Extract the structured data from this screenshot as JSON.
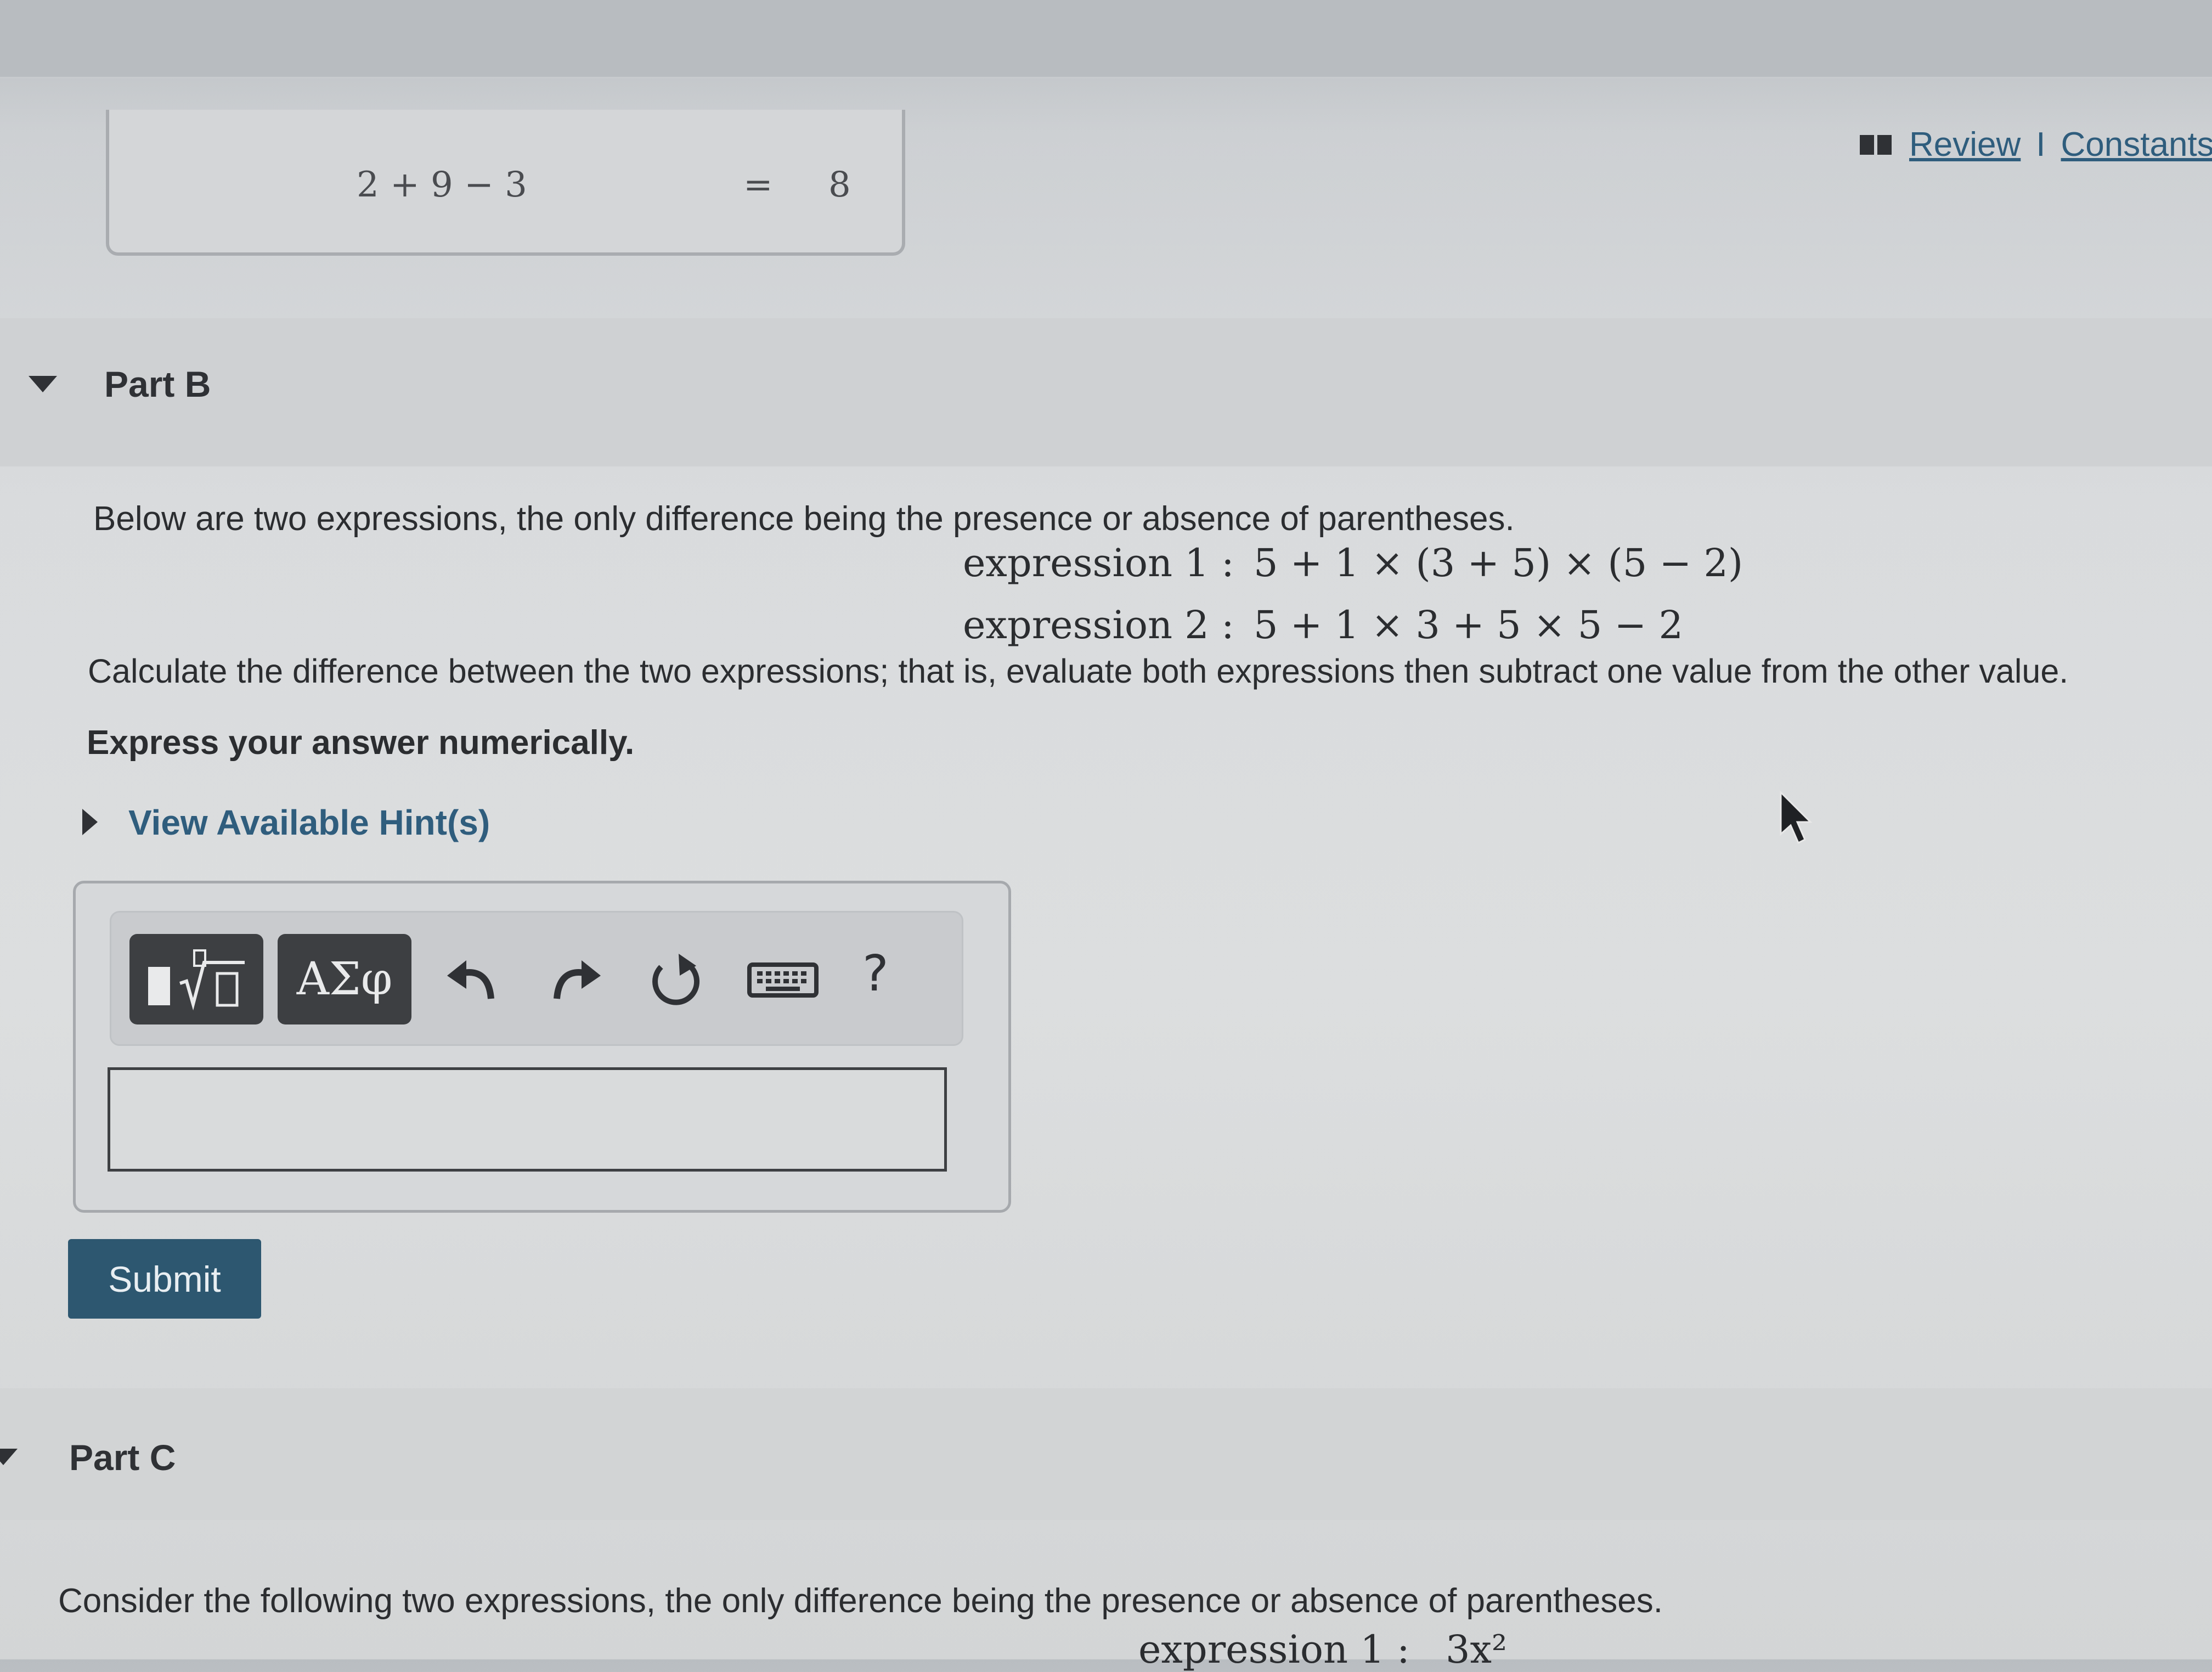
{
  "top_links": {
    "review": "Review",
    "separator": "I",
    "constants": "Constants"
  },
  "previous_part": {
    "expression": "2 + 9 − 3",
    "equals": "=",
    "result": "8"
  },
  "part_b": {
    "title": "Part B",
    "intro": "Below are two expressions, the only difference being the presence or absence of parentheses.",
    "expression1_label": "expression 1 :",
    "expression1": "5 + 1 × (3 + 5) × (5 − 2)",
    "expression2_label": "expression 2 :",
    "expression2": "5 + 1 × 3 + 5 × 5 − 2",
    "instruction": "Calculate the difference between the two expressions; that is, evaluate both expressions then subtract one value from the other value.",
    "express": "Express your answer numerically.",
    "hint_link": "View Available Hint(s)",
    "toolbar": {
      "templates_icon": "square-root-template-icon",
      "greek_label": "ΑΣφ",
      "help_label": "?"
    },
    "answer_value": "",
    "submit_label": "Submit"
  },
  "part_c": {
    "title": "Part C",
    "intro": "Consider the following two expressions, the only difference being the presence or absence of parentheses.",
    "expression1_label": "expression 1 :",
    "expression1_partial": "3x²"
  },
  "colors": {
    "link": "#2f5d7d",
    "submit_bg": "#2d5770",
    "toolbar_button": "#3d3f42"
  }
}
